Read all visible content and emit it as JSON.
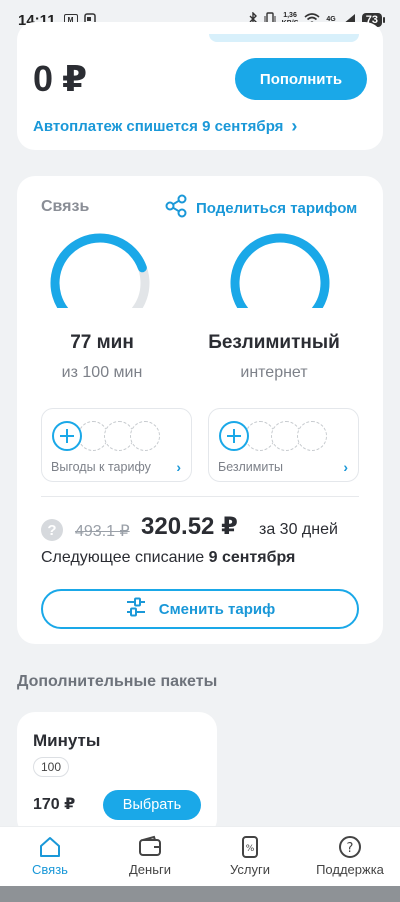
{
  "status_bar": {
    "time": "14:11",
    "icon_badge_1": "M",
    "net_speed": "1,36\nKB/S",
    "signal_label": "4G",
    "battery": "73"
  },
  "balance": {
    "amount": "0 ₽",
    "topup_label": "Пополнить",
    "autopay_text": "Автоплатеж спишется 9 сентября",
    "autopay_chevron": "›"
  },
  "tariff": {
    "title": "Связь",
    "share_label": "Поделиться тарифом",
    "gauges": [
      {
        "value": "77 мин",
        "sub": "из 100 мин",
        "fill": 0.77,
        "unlimited": false
      },
      {
        "value": "Безлимитный",
        "sub": "интернет",
        "fill": 1.0,
        "unlimited": true
      }
    ],
    "features": [
      {
        "label": "Выгоды к тарифу",
        "chevron": "›"
      },
      {
        "label": "Безлимиты",
        "chevron": "›"
      }
    ],
    "help_glyph": "?",
    "old_price": "493.1 ₽",
    "new_price": "320.52 ₽",
    "period": "за 30 дней",
    "next_charge_prefix": "Следующее списание ",
    "next_charge_date": "9 сентября",
    "change_label": "Сменить тариф"
  },
  "packages": {
    "section_title": "Дополнительные пакеты",
    "items": [
      {
        "title": "Минуты",
        "chip": "100",
        "price": "170 ₽",
        "button": "Выбрать"
      }
    ]
  },
  "nav": {
    "items": [
      {
        "label": "Связь",
        "icon": "home-icon",
        "active": true
      },
      {
        "label": "Деньги",
        "icon": "wallet-icon",
        "active": false
      },
      {
        "label": "Услуги",
        "icon": "services-icon",
        "active": false
      },
      {
        "label": "Поддержка",
        "icon": "help-icon",
        "active": false
      }
    ]
  },
  "colors": {
    "accent": "#1aa8e8",
    "text": "#2b2d33",
    "muted": "#7d8189",
    "background": "#f0f2f4"
  }
}
